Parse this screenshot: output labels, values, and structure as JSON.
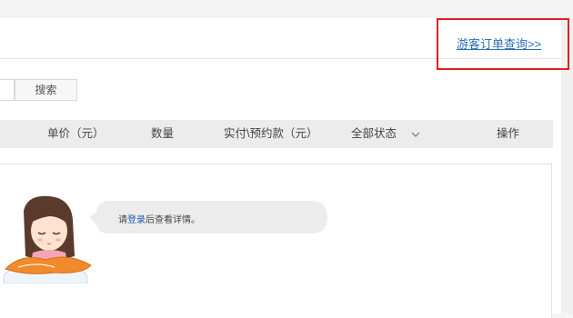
{
  "header": {
    "guest_order_link": "游客订单查询>>"
  },
  "search": {
    "button_label": "搜索",
    "input_value": ""
  },
  "table": {
    "columns": [
      "单价（元）",
      "数量",
      "实付\\预约款（元）",
      "全部状态",
      "操作"
    ]
  },
  "empty_state": {
    "prefix": "请",
    "login_link": "登录",
    "suffix": "后查看详情。"
  },
  "colors": {
    "link": "#2b6fb6",
    "highlight_box": "#e02020",
    "table_header_bg": "#ececec",
    "bubble_bg": "#ececec"
  }
}
